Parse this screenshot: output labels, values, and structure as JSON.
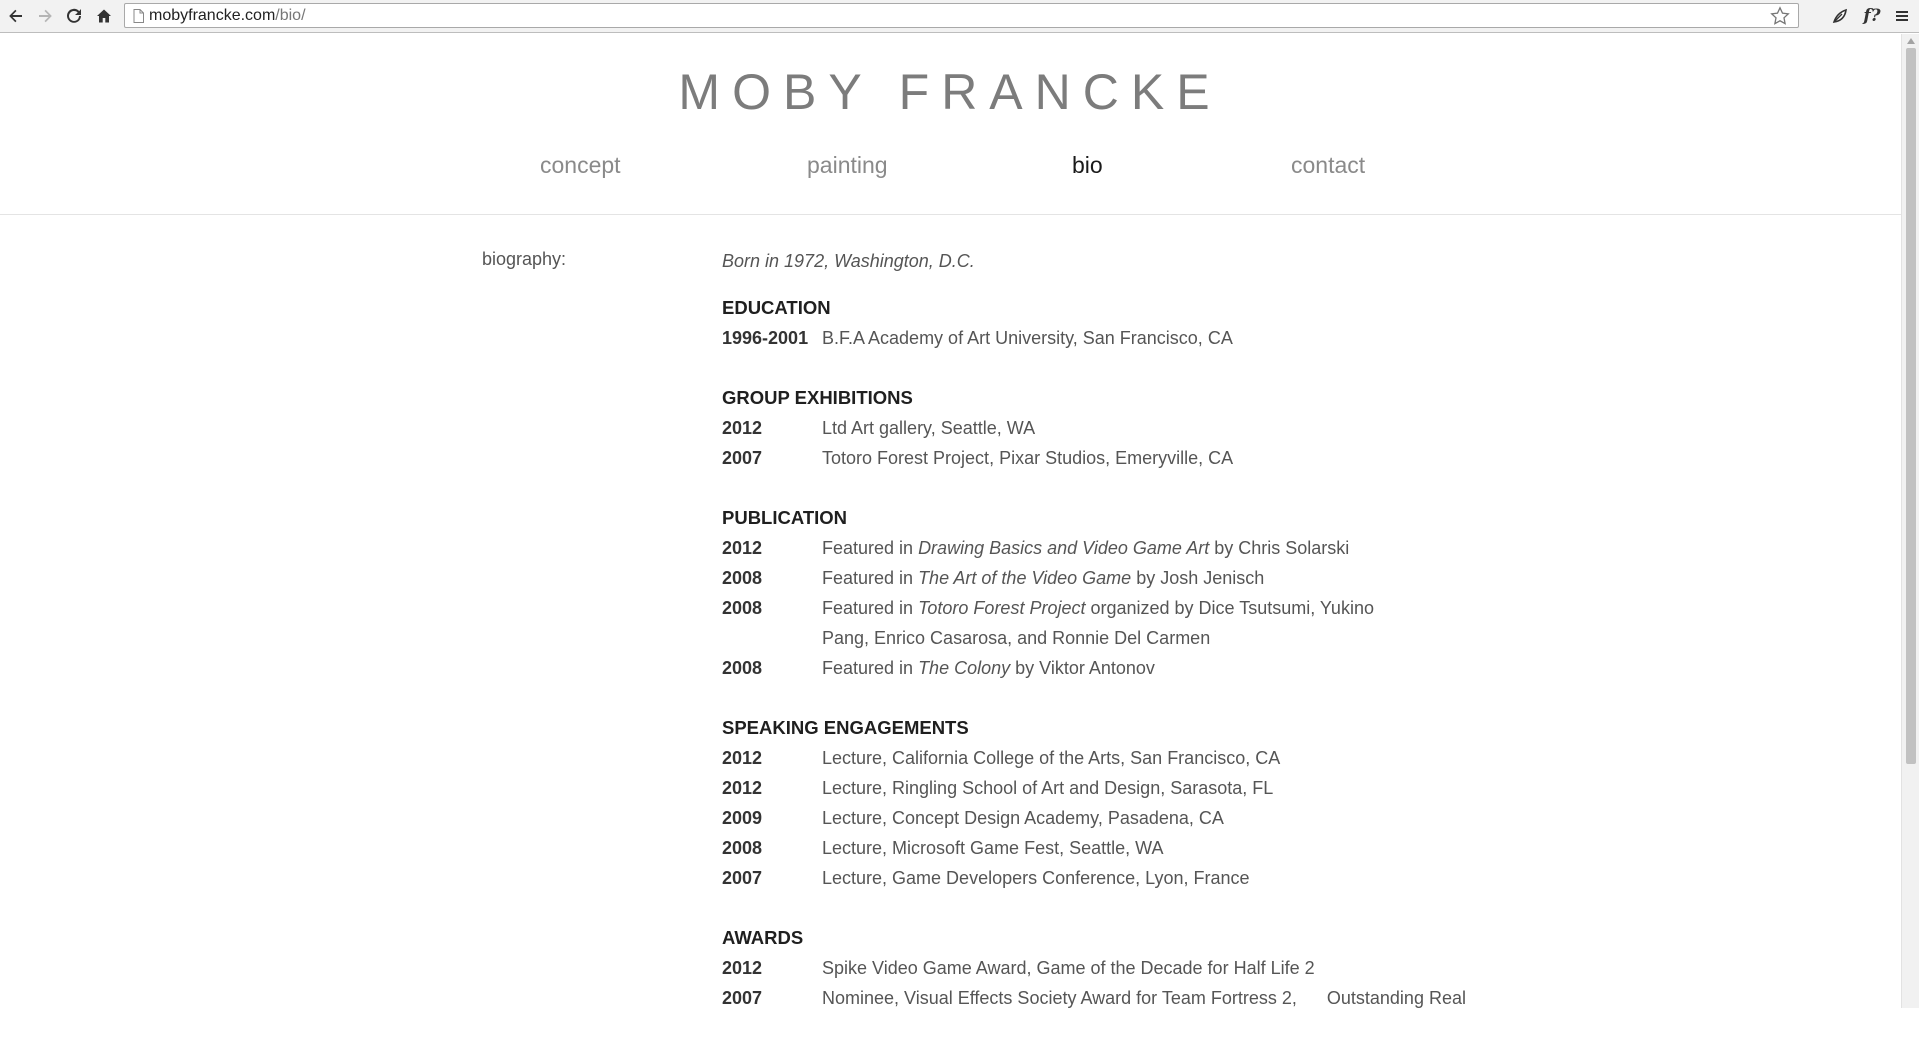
{
  "browser": {
    "url_host": "mobyfrancke.com",
    "url_path": "/bio/",
    "extension_label": "f?"
  },
  "site": {
    "title": "MOBY FRANCKE",
    "nav": [
      {
        "label": "concept",
        "active": false
      },
      {
        "label": "painting",
        "active": false
      },
      {
        "label": "bio",
        "active": true
      },
      {
        "label": "contact",
        "active": false
      }
    ]
  },
  "bio": {
    "label": "biography:",
    "born": "Born in 1972, Washington, D.C.",
    "education": {
      "title": "EDUCATION",
      "entries": [
        {
          "year": "1996-2001",
          "text": "B.F.A Academy of Art University, San Francisco, CA"
        }
      ]
    },
    "group_exhibitions": {
      "title": "GROUP EXHIBITIONS",
      "entries": [
        {
          "year": "2012",
          "text": "Ltd Art gallery, Seattle, WA"
        },
        {
          "year": "2007",
          "text": "Totoro Forest Project, Pixar Studios, Emeryville, CA"
        }
      ]
    },
    "publication": {
      "title": "PUBLICATION",
      "entries": [
        {
          "year": "2012",
          "pre": "Featured in ",
          "work": "Drawing Basics and Video Game Art",
          "post": " by Chris Solarski"
        },
        {
          "year": "2008",
          "pre": "Featured in ",
          "work": "The Art of the Video Game",
          "post": " by Josh Jenisch"
        },
        {
          "year": "2008",
          "pre": "Featured in ",
          "work": "Totoro Forest Project",
          "post": " organized by Dice Tsutsumi, Yukino Pang, Enrico Casarosa, and Ronnie Del Carmen"
        },
        {
          "year": "2008",
          "pre": "Featured in ",
          "work": "The Colony",
          "post": " by Viktor Antonov"
        }
      ]
    },
    "speaking": {
      "title": "SPEAKING ENGAGEMENTS",
      "entries": [
        {
          "year": "2012",
          "text": "Lecture, California College of the Arts, San Francisco, CA"
        },
        {
          "year": "2012",
          "text": "Lecture, Ringling School of Art and Design, Sarasota, FL"
        },
        {
          "year": "2009",
          "text": "Lecture, Concept Design Academy, Pasadena, CA"
        },
        {
          "year": "2008",
          "text": "Lecture, Microsoft Game Fest, Seattle, WA"
        },
        {
          "year": "2007",
          "text": "Lecture, Game Developers Conference, Lyon, France"
        }
      ]
    },
    "awards": {
      "title": "AWARDS",
      "entries": [
        {
          "year": "2012",
          "text": "Spike Video Game Award, Game of the Decade for Half Life 2"
        },
        {
          "year": "2007",
          "text": "Nominee, Visual Effects Society Award for Team Fortress 2,      Outstanding Real"
        }
      ]
    }
  }
}
